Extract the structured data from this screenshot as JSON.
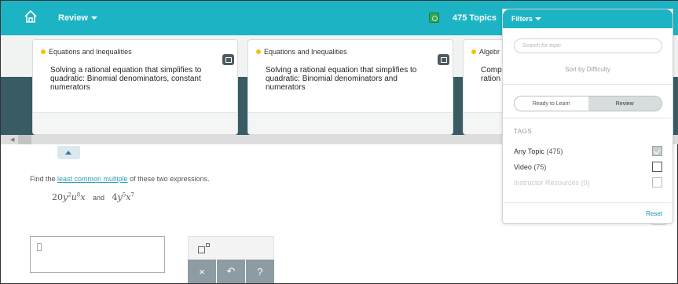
{
  "topbar": {
    "review_label": "Review",
    "topics_count": "475 Topics"
  },
  "cards": [
    {
      "category": "Equations and Inequalities",
      "title": "Solving a rational equation that simplifies to quadratic: Binomial denominators, constant numerators"
    },
    {
      "category": "Equations and Inequalities",
      "title": "Solving a rational equation that simplifies to quadratic: Binomial denominators and numerators"
    },
    {
      "category": "Algebr",
      "title": "Comp ration"
    }
  ],
  "question": {
    "prefix": "Find the ",
    "link": "least common multiple",
    "suffix": " of these two expressions.",
    "expr1": {
      "coef": "20",
      "v1": "y",
      "e1": "2",
      "v2": "u",
      "e2": "8",
      "v3": "x"
    },
    "and": "and",
    "expr2": {
      "coef": "4",
      "v1": "y",
      "e1": "5",
      "v2": "x",
      "e2": "7"
    }
  },
  "keypad": {
    "clear": "×",
    "undo": "↶",
    "help": "?"
  },
  "filters": {
    "label": "Filters",
    "search_placeholder": "Search for topic",
    "sort_label": "Sort by Difficulty",
    "toggle": {
      "left": "Ready to Learn",
      "right": "Review",
      "selected": "Review"
    },
    "tags_heading": "TAGS",
    "tags": [
      {
        "name": "Any Topic",
        "count": "(475)",
        "checked": true,
        "disabled": false
      },
      {
        "name": "Video",
        "count": "(75)",
        "checked": false,
        "disabled": false
      },
      {
        "name": "Instructor Resources",
        "count": "(0)",
        "checked": false,
        "disabled": true
      }
    ],
    "reset_label": "Reset"
  },
  "colors": {
    "accent": "#1cb4c4",
    "dark_band": "#385b64",
    "dot": "#f4c20d",
    "link": "#2a9fb7"
  }
}
